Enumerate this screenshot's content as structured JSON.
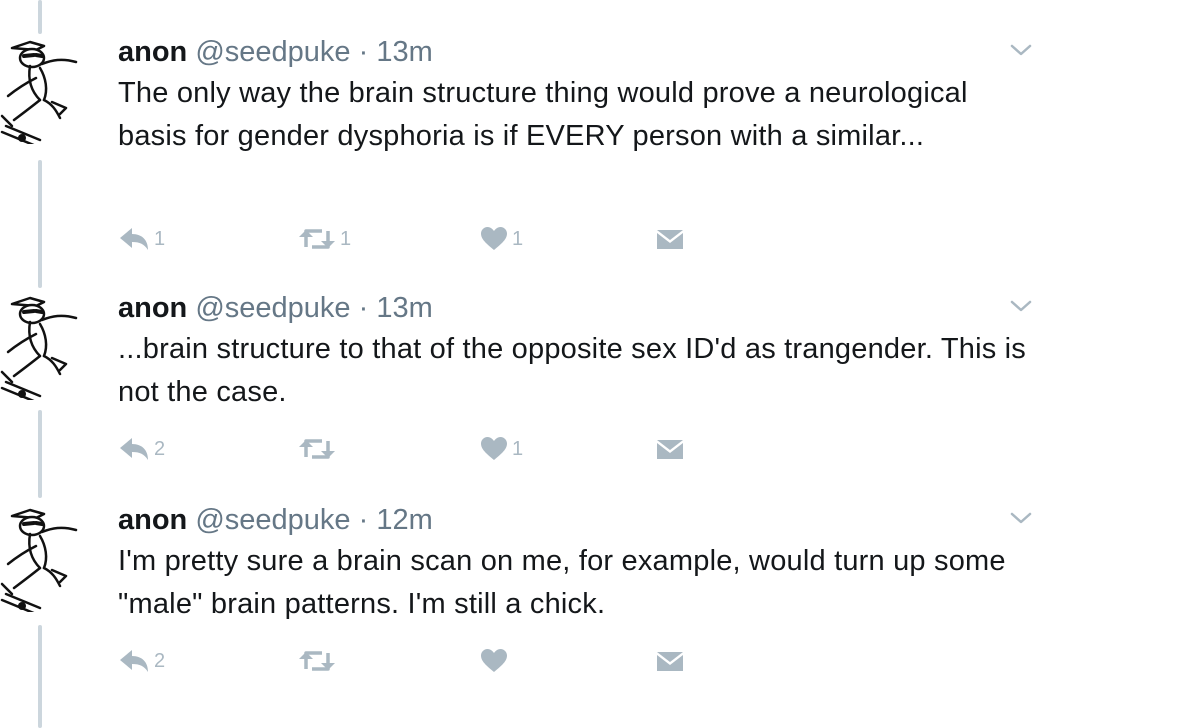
{
  "icons": {
    "avatar": "skateboarding-cartoon-avatar-icon",
    "chevron": "chevron-down-icon",
    "reply": "reply-icon",
    "retweet": "retweet-icon",
    "like": "heart-icon",
    "dm": "envelope-icon"
  },
  "colors": {
    "text": "#14171a",
    "secondary": "#657786",
    "action": "#aab8c2",
    "thread_line": "#ccd6dd"
  },
  "tweets": [
    {
      "name": "anon",
      "handle": "@seedpuke",
      "separator": "·",
      "time": "13m",
      "text": "The only way the brain structure thing would prove a neurological basis for gender dysphoria is if EVERY person with a similar...",
      "replies": "1",
      "retweets": "1",
      "likes": "1"
    },
    {
      "name": "anon",
      "handle": "@seedpuke",
      "separator": "·",
      "time": "13m",
      "text": "...brain structure to that of the opposite sex ID'd as trangender. This is not the case.",
      "replies": "2",
      "retweets": "",
      "likes": "1"
    },
    {
      "name": "anon",
      "handle": "@seedpuke",
      "separator": "·",
      "time": "12m",
      "text": "I'm pretty sure a brain scan on me, for example, would turn up some \"male\" brain patterns. I'm still a chick.",
      "replies": "2",
      "retweets": "",
      "likes": ""
    }
  ]
}
